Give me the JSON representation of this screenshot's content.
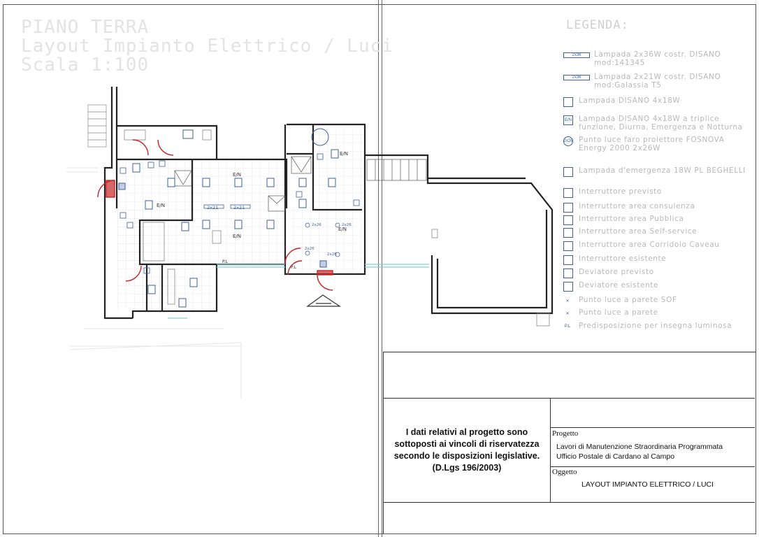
{
  "title": {
    "line1": "PIANO TERRA",
    "line2": "Layout Impianto Elettrico / Luci",
    "line3": "Scala 1:100"
  },
  "legend": {
    "title": "LEGENDA:",
    "items": [
      {
        "icon": "fluorescent-2x36-icon",
        "icon_text": "2x36",
        "text": "Lampada 2x36W costr. DISANO mod:141345"
      },
      {
        "icon": "fluorescent-2x21-icon",
        "icon_text": "2x36",
        "text": "Lampada 2x21W costr. DISANO mod:Galassia T5"
      },
      {
        "icon": "disano-4x18-icon",
        "icon_text": "",
        "text": "Lampada DISANO 4x18W"
      },
      {
        "icon": "disano-4x18-emergency-icon",
        "icon_text": "E/N",
        "text": "Lampada DISANO 4x18W a triplice funzione, Diurna, Emergenza e Notturna"
      },
      {
        "icon": "projector-point-icon",
        "icon_text": "2x26",
        "text": "Punto luce faro proiettore FOSNOVA Energy 2000 2x26W"
      },
      {
        "icon": "emergency-lamp-icon",
        "icon_text": "",
        "text": "Lampada d'emergenza 18W PL BEGHELLI"
      },
      {
        "icon": "switch-planned-icon",
        "icon_text": "",
        "text": "Interruttore previsto"
      },
      {
        "icon": "switch-consulting-icon",
        "icon_text": "",
        "text": "Interruttore area consulenza"
      },
      {
        "icon": "switch-public-icon",
        "icon_text": "",
        "text": "Interruttore area Pubblica"
      },
      {
        "icon": "switch-selfservice-icon",
        "icon_text": "",
        "text": "Interruttore area Self-service"
      },
      {
        "icon": "switch-corridor-icon",
        "icon_text": "",
        "text": "Interruttore area Corridoio Caveau"
      },
      {
        "icon": "switch-existing-icon",
        "icon_text": "",
        "text": "Interruttore esistente"
      },
      {
        "icon": "diverter-planned-icon",
        "icon_text": "",
        "text": "Deviatore previsto"
      },
      {
        "icon": "diverter-existing-icon",
        "icon_text": "",
        "text": "Deviatore esistente"
      },
      {
        "icon": "wall-light-sof-icon",
        "icon_text": "",
        "text": "Punto luce a parete SOF"
      },
      {
        "icon": "wall-light-icon",
        "icon_text": "",
        "text": "Punto luce a parete"
      },
      {
        "icon": "sign-provision-icon",
        "icon_text": "P.L",
        "text": "Predisposizione per insegna luminosa"
      }
    ]
  },
  "plan": {
    "labels": {
      "en": "E/N",
      "fixture_2x21": "2x21",
      "projector": "2x26",
      "pl": "P.L"
    }
  },
  "title_block": {
    "privacy_note": [
      "I dati relativi al progetto sono",
      "sottoposti ai vincoli di riservatezza",
      "secondo le disposizioni legislative.",
      "(D.Lgs 196/2003)"
    ],
    "project_label": "Progetto",
    "project_value": [
      "Lavori di Manutenzione Straordinaria Programmata",
      "Ufficio Postale di Cardano al Campo"
    ],
    "subject_label": "Oggetto",
    "subject_value": "LAYOUT IMPIANTO ELETTRICO / LUCI"
  },
  "colors": {
    "walls": "#222222",
    "fixture": "#3f5fa0",
    "door": "#c62828",
    "cyan_line": "#7fd3d0",
    "faint_text": "#e3e3e3",
    "grid": "#d9d9d9"
  }
}
